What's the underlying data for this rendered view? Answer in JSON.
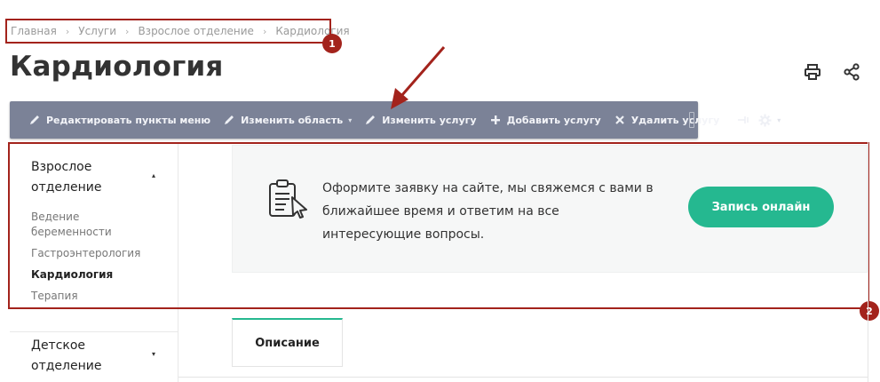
{
  "breadcrumb": {
    "items": [
      "Главная",
      "Услуги",
      "Взрослое отделение",
      "Кардиология"
    ]
  },
  "annotations": {
    "marker1": "1",
    "marker2": "2"
  },
  "page": {
    "title": "Кардиология"
  },
  "top_actions": {
    "icons": [
      "print-icon",
      "share-icon"
    ]
  },
  "toolbar": {
    "items": [
      {
        "label": "Редактировать пункты меню",
        "icon": "pencil-icon"
      },
      {
        "label": "Изменить область",
        "icon": "pencil-icon",
        "caret": "▾"
      },
      {
        "label": "Изменить услугу",
        "icon": "pencil-icon"
      },
      {
        "label": "Добавить услугу",
        "icon": "plus-icon"
      },
      {
        "label": "Удалить услугу",
        "icon": "close-icon"
      }
    ],
    "extra_icons": [
      "pin-icon",
      "gear-icon"
    ],
    "gear_caret": "▾"
  },
  "sidebar": {
    "groups": [
      {
        "title_line1": "Взрослое",
        "title_line2": "отделение",
        "caret": "▴",
        "items": [
          "Ведение",
          "беременности",
          "Гастроэнтерология",
          "Кардиология",
          "Терапия"
        ],
        "active": "Кардиология"
      },
      {
        "title_line1": "Детское",
        "title_line2": "отделение",
        "caret": "▾"
      }
    ]
  },
  "request": {
    "text_line1": "Оформите заявку на сайте, мы свяжемся с вами в",
    "text_line2": "ближайшее время и ответим на все",
    "text_line3": "интересующие вопросы.",
    "button": "Запись онлайн",
    "icon": "clipboard-cursor-icon"
  },
  "tabs": {
    "active": "Описание"
  },
  "colors": {
    "accent": "#25b890",
    "annotation": "#a3231c",
    "toolbar_bg": "#7b8297"
  }
}
